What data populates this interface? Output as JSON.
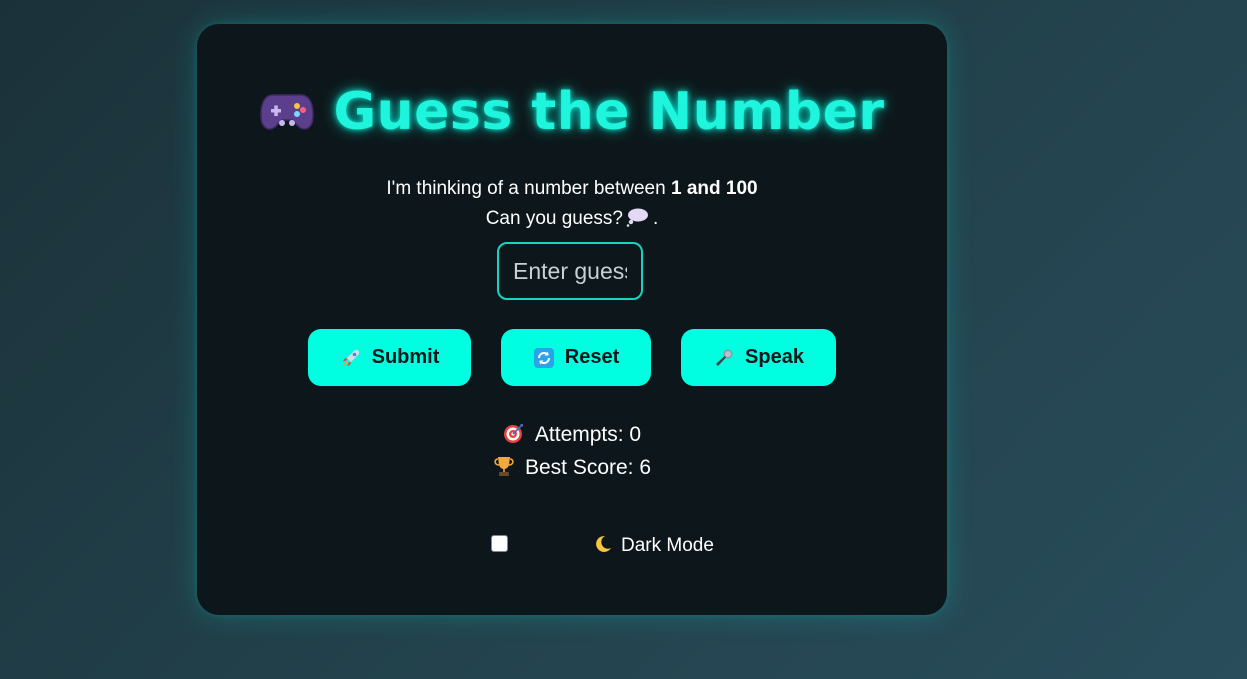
{
  "game": {
    "title": "Guess the Number",
    "title_icon": "game-controller-icon",
    "intro_prefix": "I'm thinking of a number between ",
    "intro_range": "1 and 100",
    "intro_line2": "Can you guess?",
    "intro_line2_suffix": ".",
    "thought_icon": "thought-bubble-icon"
  },
  "input": {
    "placeholder": "Enter guess",
    "value": ""
  },
  "buttons": {
    "submit_label": "Submit",
    "submit_icon": "rocket-icon",
    "reset_label": "Reset",
    "reset_icon": "refresh-icon",
    "speak_label": "Speak",
    "speak_icon": "microphone-icon"
  },
  "stats": {
    "attempts_label": "Attempts: 0",
    "attempts_icon": "target-icon",
    "best_label": "Best Score: 6",
    "best_icon": "trophy-icon"
  },
  "settings": {
    "dark_mode_label": "Dark Mode",
    "dark_mode_icon": "moon-icon",
    "dark_mode_checked": false
  },
  "colors": {
    "accent": "#00ffe1",
    "card_bg": "#0d171b",
    "page_bg": "#213f49"
  }
}
